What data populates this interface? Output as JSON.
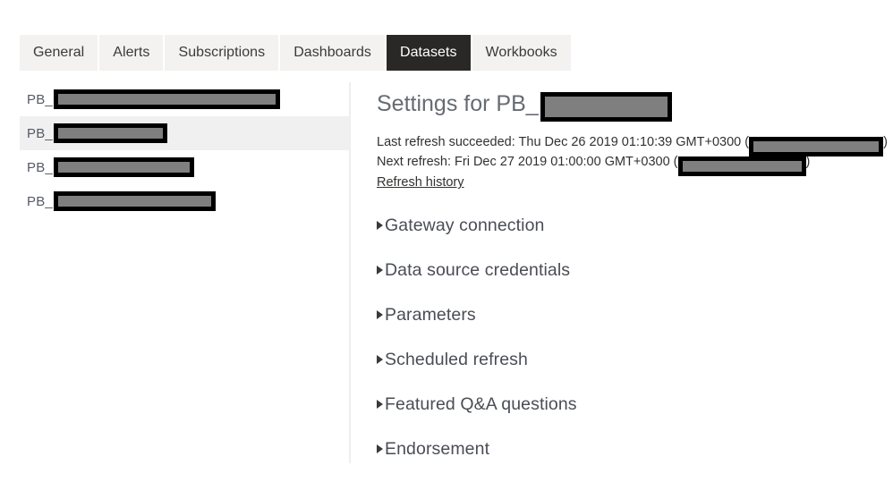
{
  "tabs": [
    {
      "label": "General",
      "active": false
    },
    {
      "label": "Alerts",
      "active": false
    },
    {
      "label": "Subscriptions",
      "active": false
    },
    {
      "label": "Dashboards",
      "active": false
    },
    {
      "label": "Datasets",
      "active": true
    },
    {
      "label": "Workbooks",
      "active": false
    }
  ],
  "dataset_list": [
    {
      "label": "PB_",
      "redacted": true,
      "selected": false
    },
    {
      "label": "PB_",
      "redacted": true,
      "selected": true
    },
    {
      "label": "PB_",
      "redacted": true,
      "selected": false
    },
    {
      "label": "PB_",
      "redacted": true,
      "selected": false
    }
  ],
  "settings": {
    "title_prefix": "Settings for PB_",
    "last_refresh": "Last refresh succeeded: Thu Dec 26 2019 01:10:39 GMT+0300 (",
    "last_refresh_suffix": ")",
    "next_refresh": "Next refresh: Fri Dec 27 2019 01:00:00 GMT+0300 (",
    "next_refresh_suffix": ")",
    "refresh_history_link": "Refresh history"
  },
  "sections": [
    {
      "label": "Gateway connection",
      "expanded": false
    },
    {
      "label": "Data source credentials",
      "expanded": false
    },
    {
      "label": "Parameters",
      "expanded": false
    },
    {
      "label": "Scheduled refresh",
      "expanded": false
    },
    {
      "label": "Featured Q&A questions",
      "expanded": false
    },
    {
      "label": "Endorsement",
      "expanded": false
    }
  ],
  "colors": {
    "active_tab_bg": "#292827",
    "tab_bg": "#f3f2f1",
    "selected_row_bg": "#f0f0f0",
    "redaction_fill": "#7f7f7f",
    "redaction_border": "#000000",
    "divider": "#eeeeee"
  }
}
